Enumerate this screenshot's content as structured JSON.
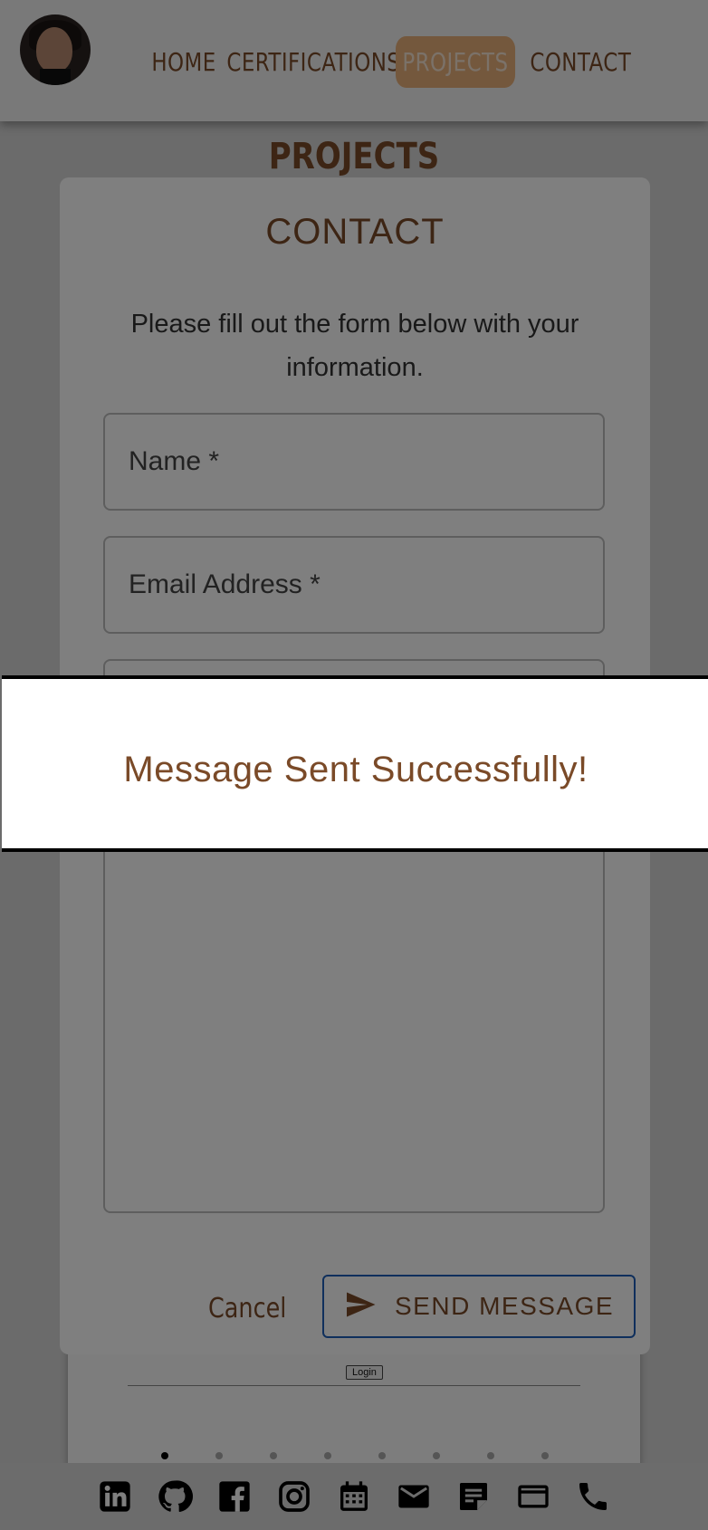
{
  "nav": {
    "items": [
      {
        "label": "HOME"
      },
      {
        "label": "CERTIFICATIONS"
      },
      {
        "label": "PROJECTS"
      },
      {
        "label": "CONTACT"
      }
    ],
    "active": "PROJECTS"
  },
  "page": {
    "heading": "PROJECTS"
  },
  "project_card": {
    "login_label": "Login"
  },
  "carousel": {
    "dots": 8,
    "active_index": 0
  },
  "dialog": {
    "title": "CONTACT",
    "subtitle": "Please fill out the form below with your information.",
    "name_placeholder": "Name *",
    "email_placeholder": "Email Address *",
    "cancel_label": "Cancel",
    "send_label": "SEND MESSAGE"
  },
  "toast": {
    "message": "Message Sent Successfully!"
  },
  "footer": {
    "icons": [
      "linkedin-icon",
      "github-icon",
      "facebook-icon",
      "instagram-icon",
      "calendar-icon",
      "email-icon",
      "note-icon",
      "credit-card-icon",
      "phone-icon"
    ]
  },
  "colors": {
    "accent": "#7a4a28",
    "active_nav_bg": "#e8b07a",
    "send_border": "#1f5fb8"
  }
}
